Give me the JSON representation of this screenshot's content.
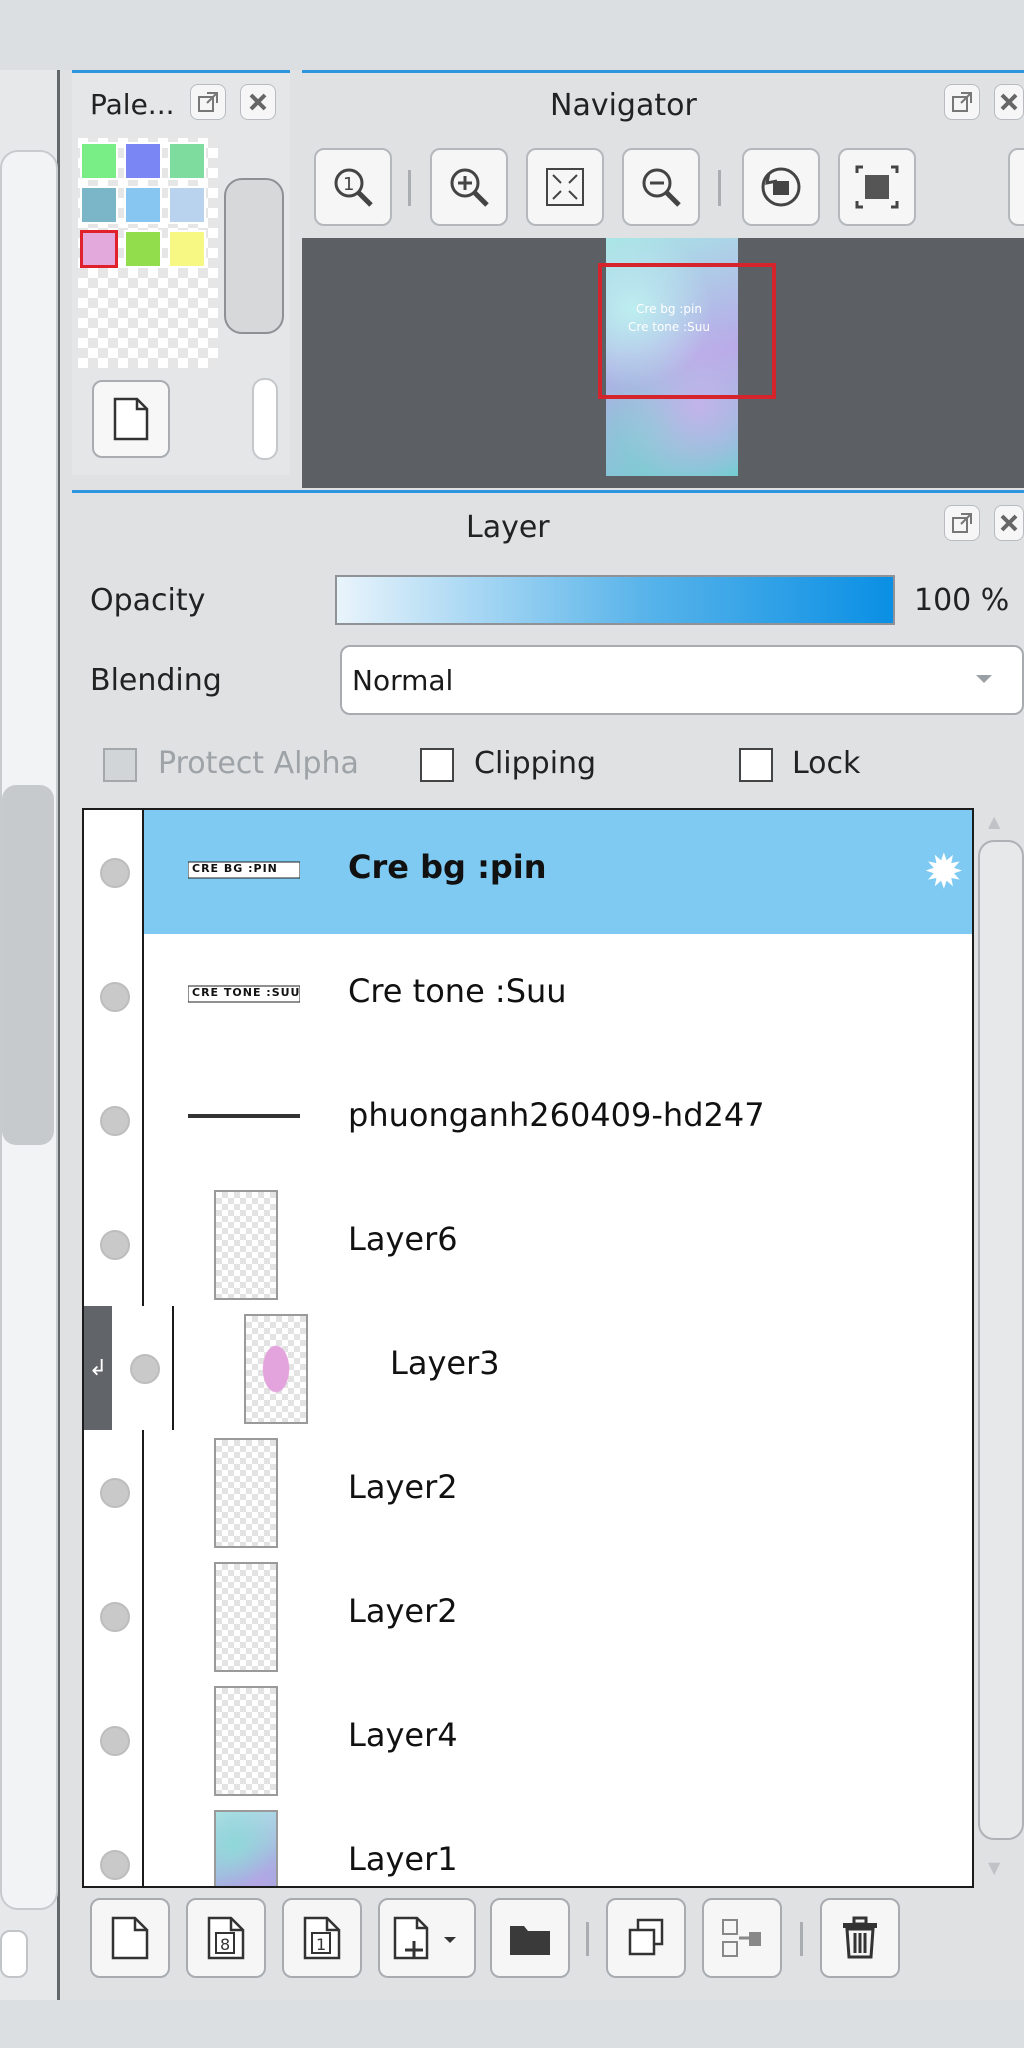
{
  "palette": {
    "title": "Pale...",
    "swatches": [
      "#79ee86",
      "#7a86f3",
      "#7fdc9f",
      "#7ab6c8",
      "#88c6f2",
      "#b9d3ef",
      "#e3a8dc",
      "#92dd4c",
      "#f7f783"
    ],
    "selected_index": 6
  },
  "navigator": {
    "title": "Navigator",
    "buttons": [
      "zoom-actual-icon",
      "zoom-in-icon",
      "fit-screen-icon",
      "zoom-out-icon",
      "rotate-icon",
      "fit-window-icon"
    ]
  },
  "layer_panel": {
    "title": "Layer",
    "opacity_label": "Opacity",
    "opacity_value": "100 %",
    "blending_label": "Blending",
    "blending_value": "Normal",
    "protect_alpha_label": "Protect Alpha",
    "clipping_label": "Clipping",
    "lock_label": "Lock",
    "layers": [
      {
        "name": "Cre bg :pin",
        "selected": true,
        "thumb": "CRE BG :PIN",
        "thumb_type": "text"
      },
      {
        "name": "Cre tone :Suu",
        "selected": false,
        "thumb": "CRE TONE :SUU",
        "thumb_type": "text"
      },
      {
        "name": "phuonganh260409-hd247",
        "selected": false,
        "thumb_type": "line"
      },
      {
        "name": "Layer6",
        "selected": false,
        "thumb_type": "checker"
      },
      {
        "name": "Layer3",
        "selected": false,
        "thumb_type": "pink",
        "clipped": true
      },
      {
        "name": "Layer2",
        "selected": false,
        "thumb_type": "checker"
      },
      {
        "name": "Layer2",
        "selected": false,
        "thumb_type": "checker"
      },
      {
        "name": "Layer4",
        "selected": false,
        "thumb_type": "checker"
      },
      {
        "name": "Layer1",
        "selected": false,
        "thumb_type": "image"
      }
    ]
  },
  "toolbar": {
    "buttons": [
      "new-layer-icon",
      "new-8bit-layer-icon",
      "new-1bit-layer-icon",
      "add-layer-dropdown-icon",
      "folder-icon",
      "duplicate-icon",
      "merge-down-icon",
      "delete-icon"
    ]
  },
  "nav_card": {
    "line1": "Cre bg :pin",
    "line2": "Cre tone :Suu"
  }
}
